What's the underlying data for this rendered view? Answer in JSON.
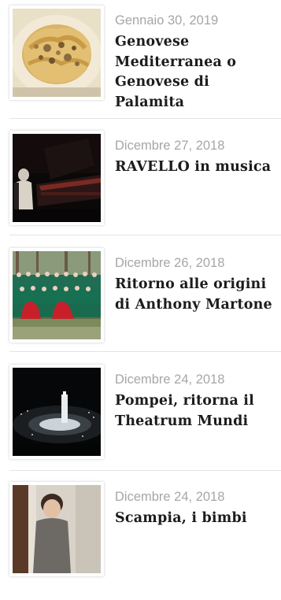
{
  "posts": [
    {
      "date": "Gennaio 30, 2019",
      "title": "Genovese\nMediterranea o\nGenovese di\nPalamita",
      "image_icon": "pasta-dish-photo"
    },
    {
      "date": "Dicembre 27, 2018",
      "title": "RAVELLO in musica",
      "image_icon": "pianist-concert-photo"
    },
    {
      "date": "Dicembre 26, 2018",
      "title": "Ritorno alle origini\ndi Anthony Martone",
      "image_icon": "choir-group-photo"
    },
    {
      "date": "Dicembre 24, 2018",
      "title": "Pompei, ritorna il\nTheatrum Mundi",
      "image_icon": "night-theatre-photo"
    },
    {
      "date": "Dicembre 24, 2018",
      "title": "Scampia, i bimbi",
      "image_icon": "child-portrait-photo"
    }
  ],
  "colors": {
    "date_text": "#a6a6a6",
    "title_text": "#1c1c1c",
    "separator": "#e3e3e3"
  }
}
